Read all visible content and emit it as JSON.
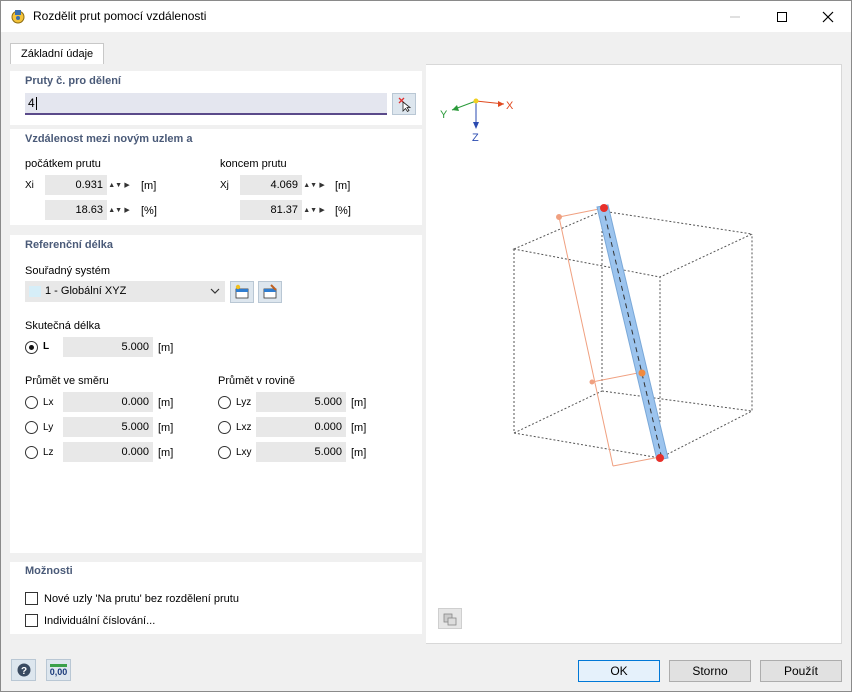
{
  "window": {
    "title": "Rozdělit prut pomocí vzdálenosti"
  },
  "tabs": [
    {
      "label": "Základní údaje"
    }
  ],
  "members": {
    "title": "Pruty č. pro dělení",
    "value": "4"
  },
  "distance": {
    "title": "Vzdálenost mezi novým uzlem a",
    "start_label": "počátkem prutu",
    "end_label": "koncem prutu",
    "xi_label": "Xi",
    "xj_label": "Xj",
    "xi_m": "0.931",
    "xi_pct": "18.63",
    "xj_m": "4.069",
    "xj_pct": "81.37",
    "unit_m": "[m]",
    "unit_pct": "[%]"
  },
  "reference": {
    "title": "Referenční délka",
    "cs_label": "Souřadný systém",
    "cs_value": "1 - Globální XYZ",
    "real_label": "Skutečná délka",
    "L_label": "L",
    "L_value": "5.000",
    "proj_dir_label": "Průmět ve směru",
    "proj_plane_label": "Průmět v rovině",
    "Lx_label": "Lx",
    "Lx_value": "0.000",
    "Ly_label": "Ly",
    "Ly_value": "5.000",
    "Lz_label": "Lz",
    "Lz_value": "0.000",
    "Lyz_label": "Lyz",
    "Lyz_value": "5.000",
    "Lxz_label": "Lxz",
    "Lxz_value": "0.000",
    "Lxy_label": "Lxy",
    "Lxy_value": "5.000",
    "unit": "[m]"
  },
  "options": {
    "title": "Možnosti",
    "opt1": "Nové uzly 'Na prutu' bez rozdělení prutu",
    "opt2": "Individuální číslování..."
  },
  "axes": {
    "x": "X",
    "y": "Y",
    "z": "Z"
  },
  "footer": {
    "decimal_label": "0,00",
    "ok": "OK",
    "cancel": "Storno",
    "apply": "Použít"
  },
  "colors": {
    "accent": "#4a5a78",
    "member": "#9cc4ee",
    "node": "#e8302a",
    "dimension": "#f0a080"
  }
}
